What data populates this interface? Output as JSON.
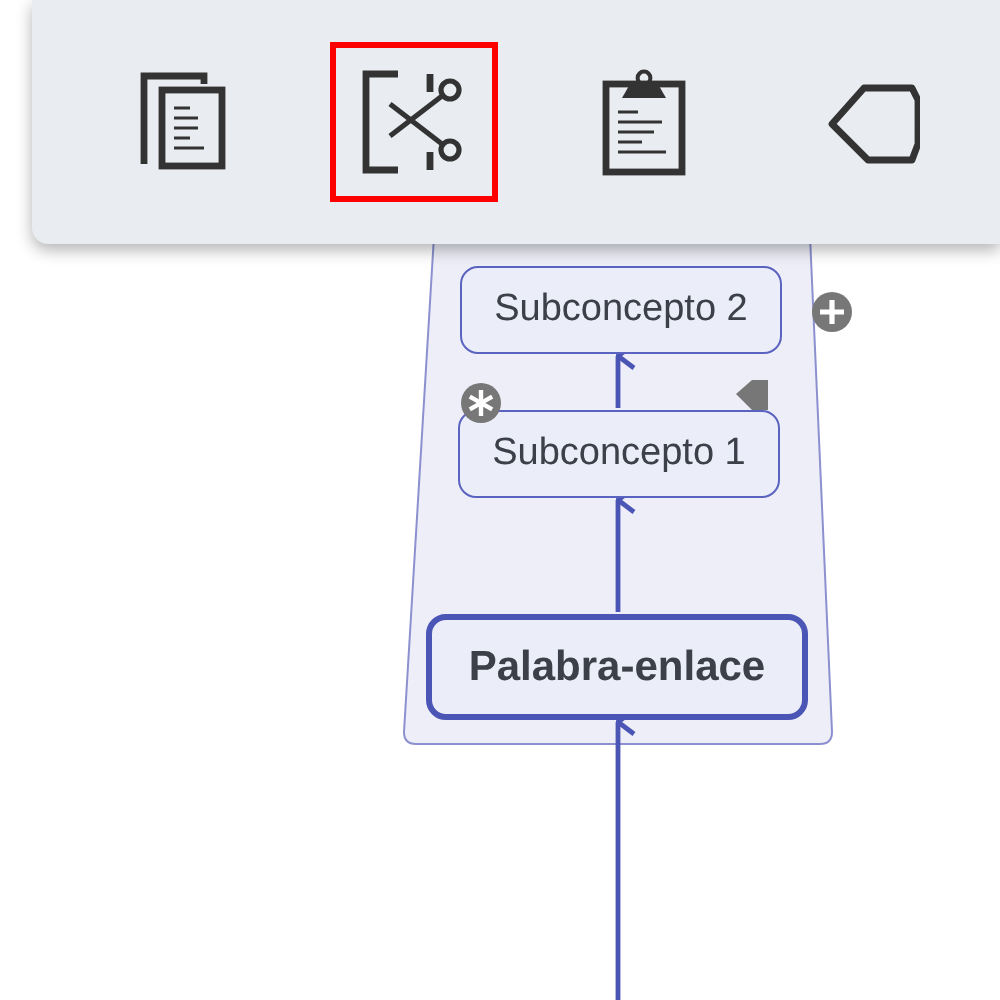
{
  "toolbar": {
    "tools": [
      {
        "kind": "copy",
        "selected": false
      },
      {
        "kind": "cut",
        "selected": true
      },
      {
        "kind": "paste",
        "selected": false
      },
      {
        "kind": "shape",
        "selected": false
      }
    ]
  },
  "map": {
    "nodes": [
      {
        "label": "Subconcepto 2",
        "kind": "concept"
      },
      {
        "label": "Subconcepto 1",
        "kind": "concept"
      },
      {
        "label": "Palabra-enlace",
        "kind": "linking"
      }
    ]
  }
}
